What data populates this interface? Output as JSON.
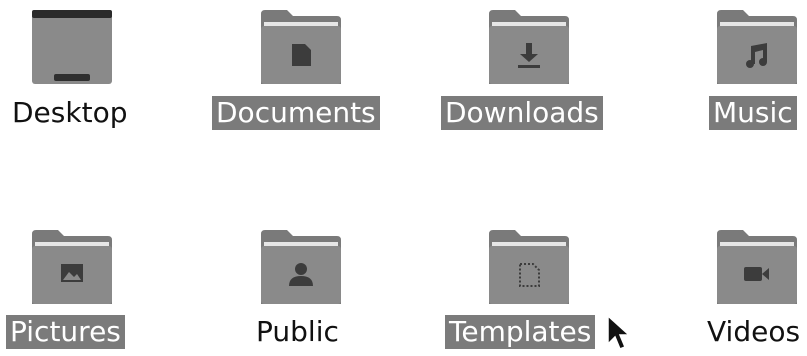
{
  "desktop_icons": [
    {
      "label": "Desktop",
      "icon": "desktop-icon",
      "selected": false
    },
    {
      "label": "Documents",
      "icon": "document-icon",
      "selected": true
    },
    {
      "label": "Downloads",
      "icon": "download-icon",
      "selected": true
    },
    {
      "label": "Music",
      "icon": "music-note-icon",
      "selected": true
    },
    {
      "label": "Pictures",
      "icon": "picture-icon",
      "selected": true
    },
    {
      "label": "Public",
      "icon": "person-icon",
      "selected": false
    },
    {
      "label": "Templates",
      "icon": "template-icon",
      "selected": true
    },
    {
      "label": "Videos",
      "icon": "video-camera-icon",
      "selected": false
    }
  ],
  "colors": {
    "folder_body": "#8a8a8a",
    "folder_tab": "#7a7a7a",
    "folder_emblem": "#3c3c3c",
    "selection": "#7b7b7b"
  }
}
